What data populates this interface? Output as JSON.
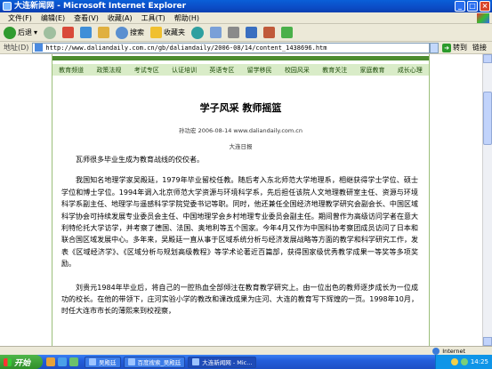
{
  "window": {
    "title": "大连新闻网 - Microsoft Internet Explorer"
  },
  "menu": [
    "文件(F)",
    "编辑(E)",
    "查看(V)",
    "收藏(A)",
    "工具(T)",
    "帮助(H)"
  ],
  "toolbar": {
    "back": "后退",
    "search": "搜索",
    "favorites": "收藏夹"
  },
  "address": {
    "label": "地址(D)",
    "url": "http://www.daliandaily.com.cn/gb/daliandaily/2006-08/14/content_1438696.htm",
    "go": "转到",
    "links": "链接"
  },
  "nav": [
    "教育频道",
    "政策法规",
    "考试专区",
    "认证培训",
    "英语专区",
    "留学移民",
    "校园风采",
    "教育关注",
    "家庭教育",
    "成长心理"
  ],
  "article": {
    "title": "学子风采  教师摇篮",
    "meta": "孙功宏  2006-08-14  www.daliandaily.com.cn",
    "source": "大连日报",
    "lead": "瓦师很多毕业生成为教育战线的佼佼者。",
    "paragraphs": [
      "我国知名地理学家吴殿廷，1979年毕业留校任教。随后考入东北师范大学地理系，相继获得学士学位、硕士学位和博士学位。1994年调入北京师范大学资源与环境科学系，先后担任该院人文地理教研室主任、资源与环境科学系副主任、地理学与遥感科学学院党委书记等职。同时，他还兼任全国经济地理教学研究会副会长、中国区域科学协会可持续发展专业委员会主任、中国地理学会乡村地理专业委员会副主任。期间曾作为高级访问学者在意大利特伦托大学访学，并考察了德国、法国、奥地利等五个国家。今年4月又作为中国科协考察团成员访问了日本和联合国区域发展中心。多年来，吴殿廷一直从事于区域系统分析与经济发展战略等方面的教学和科学研究工作，发表《区域经济学》、《区域分析与规划高级教程》等学术论著近百篇部，获得国家级优秀教学成果一等奖等多项奖励。",
      "刘贵元1984年毕业后，将自己的一腔热血全部倾注在教育教学研究上。由一位出色的教师逐步成长为一位成功的校长。在他的带领下，庄河实验小学的教改和课改成果为庄河、大连的教育写下辉煌的一页。1998年10月，时任大连市市长的薄熙来到校视察，"
    ]
  },
  "statusbar": {
    "zone": "Internet"
  },
  "taskbar": {
    "start": "开始",
    "tasks": [
      "吴殿廷",
      "百度搜索_吴殿廷",
      "大连新闻网 - Mic..."
    ],
    "clock": "14:25"
  }
}
